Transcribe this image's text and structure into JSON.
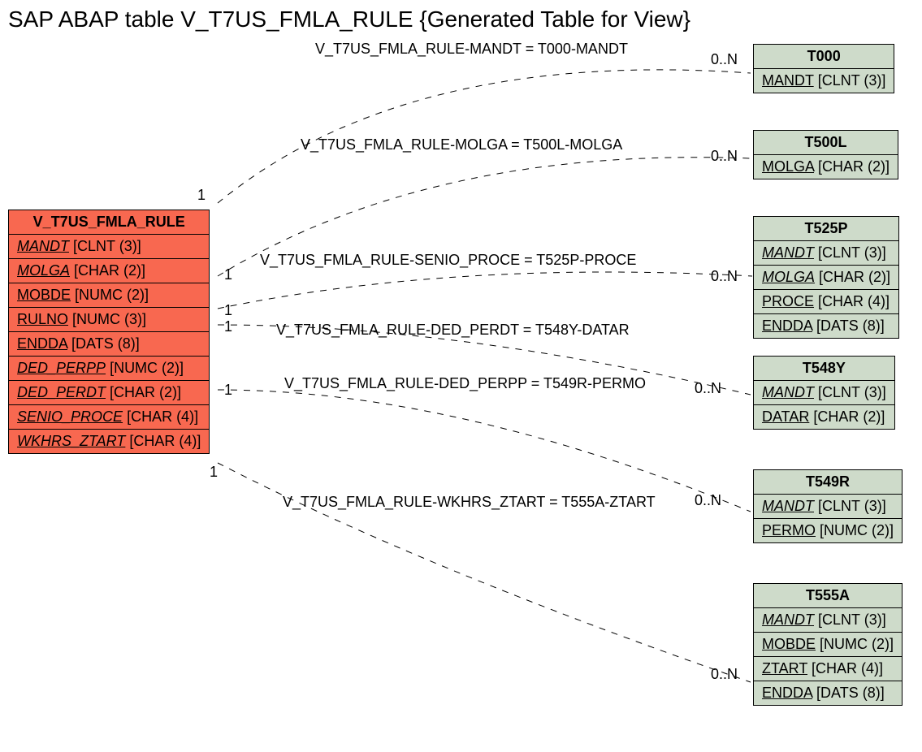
{
  "title": "SAP ABAP table V_T7US_FMLA_RULE {Generated Table for View}",
  "main_entity": {
    "name": "V_T7US_FMLA_RULE",
    "fields": [
      {
        "name": "MANDT",
        "type": "[CLNT (3)]",
        "italic": true
      },
      {
        "name": "MOLGA",
        "type": "[CHAR (2)]",
        "italic": true
      },
      {
        "name": "MOBDE",
        "type": "[NUMC (2)]",
        "italic": false
      },
      {
        "name": "RULNO",
        "type": "[NUMC (3)]",
        "italic": false
      },
      {
        "name": "ENDDA",
        "type": "[DATS (8)]",
        "italic": false
      },
      {
        "name": "DED_PERPP",
        "type": "[NUMC (2)]",
        "italic": true
      },
      {
        "name": "DED_PERDT",
        "type": "[CHAR (2)]",
        "italic": true
      },
      {
        "name": "SENIO_PROCE",
        "type": "[CHAR (4)]",
        "italic": true
      },
      {
        "name": "WKHRS_ZTART",
        "type": "[CHAR (4)]",
        "italic": true
      }
    ]
  },
  "related_entities": [
    {
      "name": "T000",
      "fields": [
        {
          "name": "MANDT",
          "type": "[CLNT (3)]",
          "italic": false
        }
      ]
    },
    {
      "name": "T500L",
      "fields": [
        {
          "name": "MOLGA",
          "type": "[CHAR (2)]",
          "italic": false
        }
      ]
    },
    {
      "name": "T525P",
      "fields": [
        {
          "name": "MANDT",
          "type": "[CLNT (3)]",
          "italic": true
        },
        {
          "name": "MOLGA",
          "type": "[CHAR (2)]",
          "italic": true
        },
        {
          "name": "PROCE",
          "type": "[CHAR (4)]",
          "italic": false
        },
        {
          "name": "ENDDA",
          "type": "[DATS (8)]",
          "italic": false
        }
      ]
    },
    {
      "name": "T548Y",
      "fields": [
        {
          "name": "MANDT",
          "type": "[CLNT (3)]",
          "italic": true
        },
        {
          "name": "DATAR",
          "type": "[CHAR (2)]",
          "italic": false
        }
      ]
    },
    {
      "name": "T549R",
      "fields": [
        {
          "name": "MANDT",
          "type": "[CLNT (3)]",
          "italic": true
        },
        {
          "name": "PERMO",
          "type": "[NUMC (2)]",
          "italic": false
        }
      ]
    },
    {
      "name": "T555A",
      "fields": [
        {
          "name": "MANDT",
          "type": "[CLNT (3)]",
          "italic": true
        },
        {
          "name": "MOBDE",
          "type": "[NUMC (2)]",
          "italic": false
        },
        {
          "name": "ZTART",
          "type": "[CHAR (4)]",
          "italic": false
        },
        {
          "name": "ENDDA",
          "type": "[DATS (8)]",
          "italic": false
        }
      ]
    }
  ],
  "relations": [
    {
      "label": "V_T7US_FMLA_RULE-MANDT = T000-MANDT",
      "left_card": "1",
      "right_card": "0..N"
    },
    {
      "label": "V_T7US_FMLA_RULE-MOLGA = T500L-MOLGA",
      "left_card": "1",
      "right_card": "0..N"
    },
    {
      "label": "V_T7US_FMLA_RULE-SENIO_PROCE = T525P-PROCE",
      "left_card": "1",
      "right_card": "0..N"
    },
    {
      "label": "V_T7US_FMLA_RULE-DED_PERDT = T548Y-DATAR",
      "left_card": "1",
      "right_card": ""
    },
    {
      "label": "V_T7US_FMLA_RULE-DED_PERPP = T549R-PERMO",
      "left_card": "1",
      "right_card": "0..N"
    },
    {
      "label": "V_T7US_FMLA_RULE-WKHRS_ZTART = T555A-ZTART",
      "left_card": "1",
      "right_card": "0..N"
    }
  ],
  "extra_card_t555a": "0..N"
}
